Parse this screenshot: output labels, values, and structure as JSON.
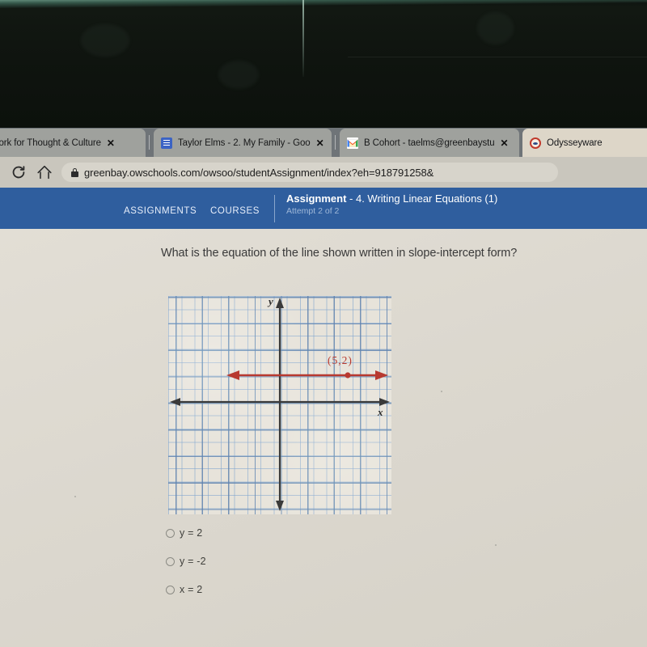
{
  "browser": {
    "tabs": [
      {
        "title": "sswork for Thought & Culture",
        "favicon": "none-icon",
        "close_label": "✕",
        "active": false
      },
      {
        "title": "Taylor Elms - 2. My Family - Goo",
        "favicon": "google-docs-icon",
        "close_label": "✕",
        "active": false
      },
      {
        "title": "B Cohort - taelms@greenbaystu",
        "favicon": "gmail-icon",
        "close_label": "✕",
        "active": false
      },
      {
        "title": "Odysseyware",
        "favicon": "odysseyware-icon",
        "close_label": "",
        "active": true
      }
    ],
    "reload_label": "C",
    "url": "greenbay.owschools.com/owsoo/studentAssignment/index?eh=918791258&",
    "lock_icon": "lock-icon"
  },
  "appnav": {
    "assignments_label": "ASSIGNMENTS",
    "courses_label": "COURSES",
    "assignment_word": "Assignment",
    "assignment_name": "- 4. Writing Linear Equations (1)",
    "attempt": "Attempt 2 of 2",
    "bar_color": "#2f5e9e"
  },
  "question": {
    "text": "What is the equation of the line shown written in slope-intercept form?"
  },
  "chart_data": {
    "type": "line",
    "title": "",
    "xlabel": "x",
    "ylabel": "y",
    "xlim": [
      -8,
      9
    ],
    "ylim": [
      -8,
      8
    ],
    "grid": true,
    "grid_minor_spacing": 1,
    "grid_major_spacing": 2,
    "legend": "none",
    "series": [
      {
        "name": "y = 2",
        "equation": "y = 2",
        "color": "#b8392f",
        "style": "double-arrow horizontal line",
        "x": [
          -4,
          9
        ],
        "y": [
          2,
          2
        ]
      }
    ],
    "points": [
      {
        "label": "(5,2)",
        "x": 5,
        "y": 2,
        "color": "#b8392f"
      }
    ],
    "annotations": [
      {
        "text": "(5,2)",
        "x": 5.6,
        "y": 3.2,
        "color": "#b8392f"
      }
    ],
    "axes": {
      "x_axis_color": "#333333",
      "y_axis_color": "#333333",
      "x_arrowheads": "both",
      "y_arrowheads": "both"
    }
  },
  "options": [
    {
      "label": "y = 2",
      "selected": false
    },
    {
      "label": "y = -2",
      "selected": false
    },
    {
      "label": "x = 2",
      "selected": false
    }
  ],
  "colors": {
    "nav_blue": "#2f5e9e",
    "line_red": "#b8392f",
    "grid_blue": "#5f82af",
    "page_bg": "#ddd9d0"
  }
}
